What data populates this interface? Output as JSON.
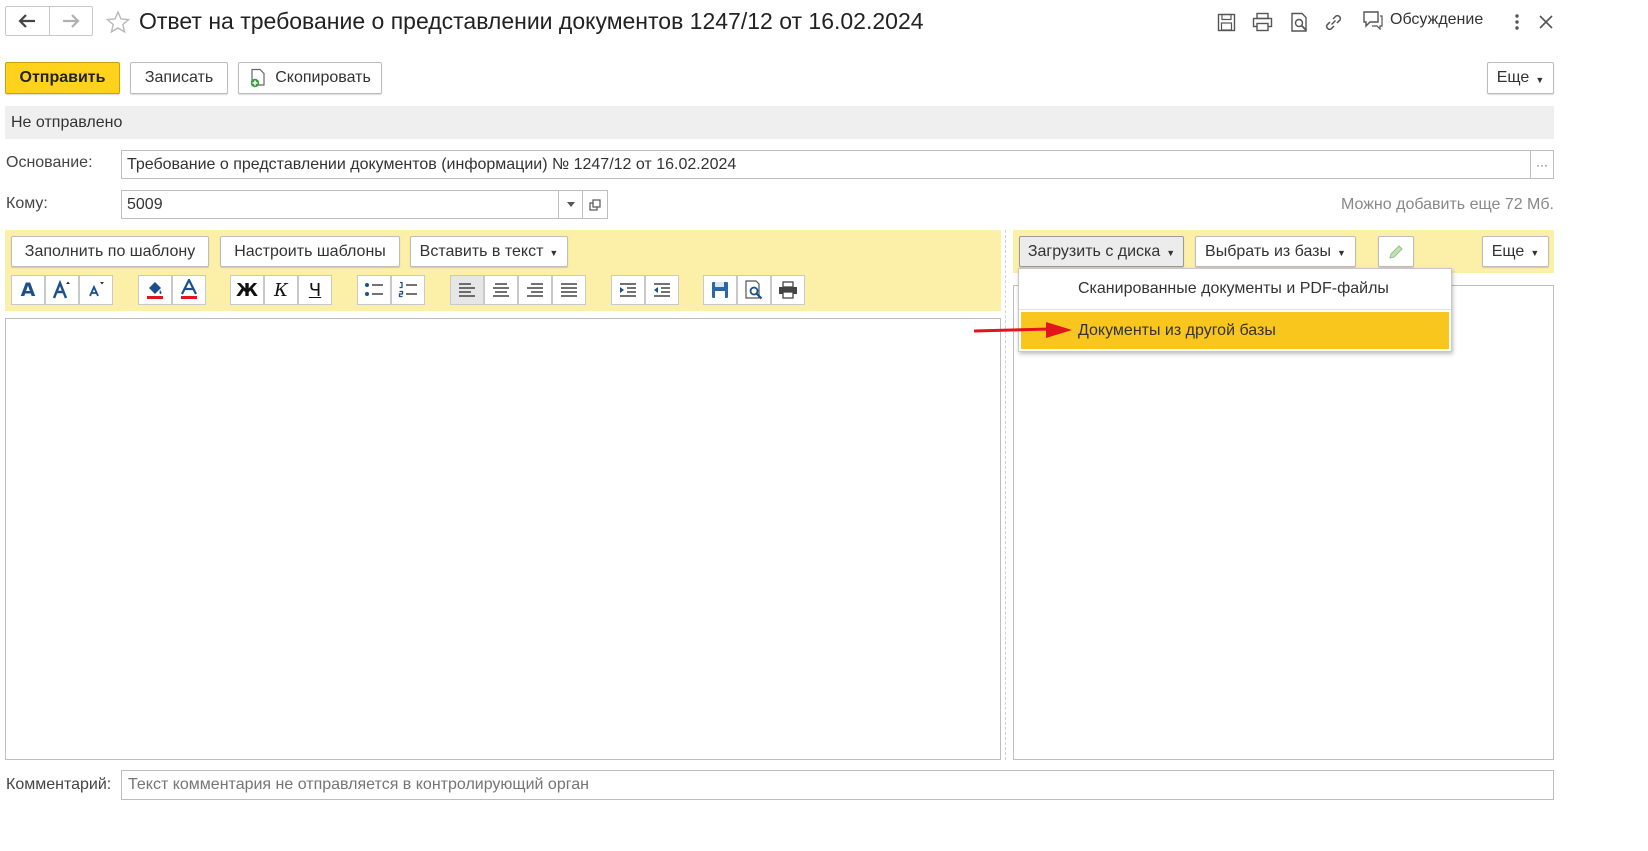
{
  "window": {
    "title": "Ответ на требование о представлении документов 1247/12 от 16.02.2024",
    "discussion_label": "Обсуждение"
  },
  "command_bar": {
    "send_label": "Отправить",
    "save_label": "Записать",
    "copy_label": "Скопировать",
    "more_label": "Еще"
  },
  "status": {
    "text": "Не отправлено"
  },
  "form": {
    "basis_label": "Основание:",
    "basis_value": "Требование о представлении документов (информации) № 1247/12 от 16.02.2024",
    "to_label": "Кому:",
    "to_value": "5009",
    "size_note": "Можно добавить еще 72 Мб.",
    "comment_label": "Комментарий:",
    "comment_placeholder": "Текст комментария не отправляется в контролирующий орган"
  },
  "editor": {
    "fill_template_label": "Заполнить по шаблону",
    "setup_templates_label": "Настроить шаблоны",
    "insert_text_label": "Вставить в текст",
    "format_glyphs": {
      "font": "A",
      "bold": "Ж",
      "italic": "К",
      "underline": "Ч"
    }
  },
  "attachments": {
    "load_from_disk_label": "Загрузить с диска",
    "select_from_base_label": "Выбрать из базы",
    "more_label": "Еще",
    "menu_items": [
      {
        "label": "Сканированные документы и PDF-файлы",
        "highlighted": false
      },
      {
        "label": "Документы из другой базы",
        "highlighted": true
      }
    ]
  },
  "colors": {
    "accent_yellow": "#ffd21c",
    "toolbar_bg": "#fcefa8",
    "highlight_item": "#f9c61d",
    "status_bg": "#efefef",
    "arrow_red": "#e3141c"
  }
}
